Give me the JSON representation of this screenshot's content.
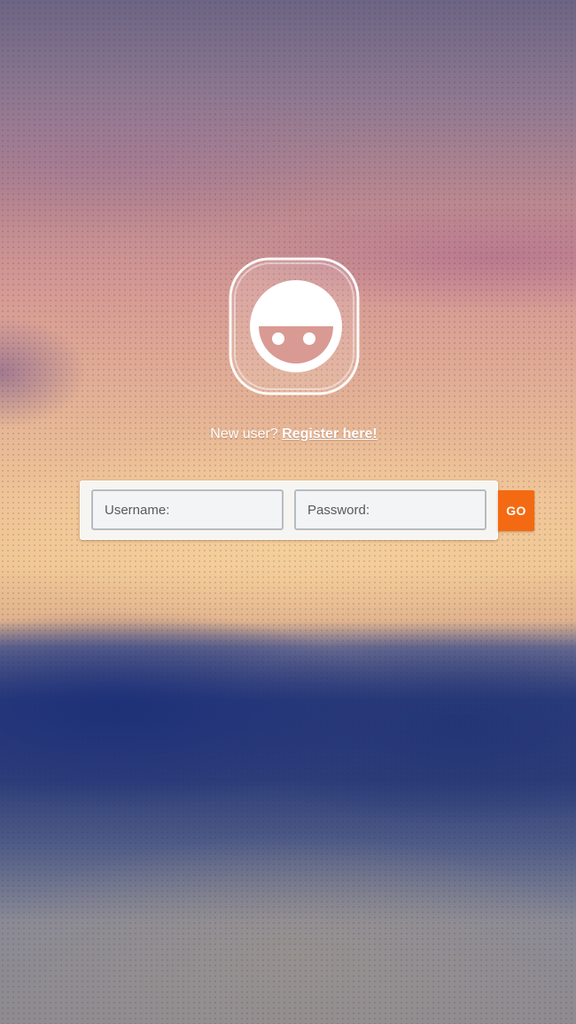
{
  "register": {
    "prompt": "New user? ",
    "link_label": "Register here!"
  },
  "login": {
    "username_placeholder": "Username:",
    "password_placeholder": "Password:",
    "go_label": "GO"
  },
  "icons": {
    "logo": "smiley-face-logo-icon"
  },
  "colors": {
    "accent": "#f46a12"
  }
}
